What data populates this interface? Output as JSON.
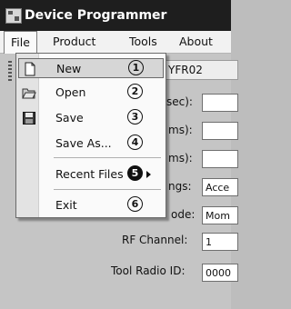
{
  "window": {
    "title": "Device Programmer"
  },
  "menubar": {
    "items": [
      "File",
      "Product",
      "Tools",
      "About"
    ]
  },
  "header_value": "YFR02",
  "form": {
    "partial_labels": [
      "sec):",
      "ms):",
      "ms):",
      "ngs:",
      "ode:"
    ],
    "partial_values": [
      "",
      "",
      "",
      "Acce",
      "Mom"
    ],
    "rf_channel_label": "RF Channel:",
    "rf_channel_value": "1",
    "tool_radio_id_label": "Tool Radio ID:",
    "tool_radio_id_value": "0000"
  },
  "file_menu": {
    "items": [
      {
        "label": "New",
        "num": "1",
        "icon": "new-file-icon",
        "highlighted": true
      },
      {
        "label": "Open",
        "num": "2",
        "icon": "open-folder-icon"
      },
      {
        "label": "Save",
        "num": "3",
        "icon": "save-disk-icon"
      },
      {
        "label": "Save As...",
        "num": "4"
      },
      {
        "label": "Recent Files",
        "num": "5",
        "submenu": true
      },
      {
        "label": "Exit",
        "num": "6"
      }
    ]
  }
}
